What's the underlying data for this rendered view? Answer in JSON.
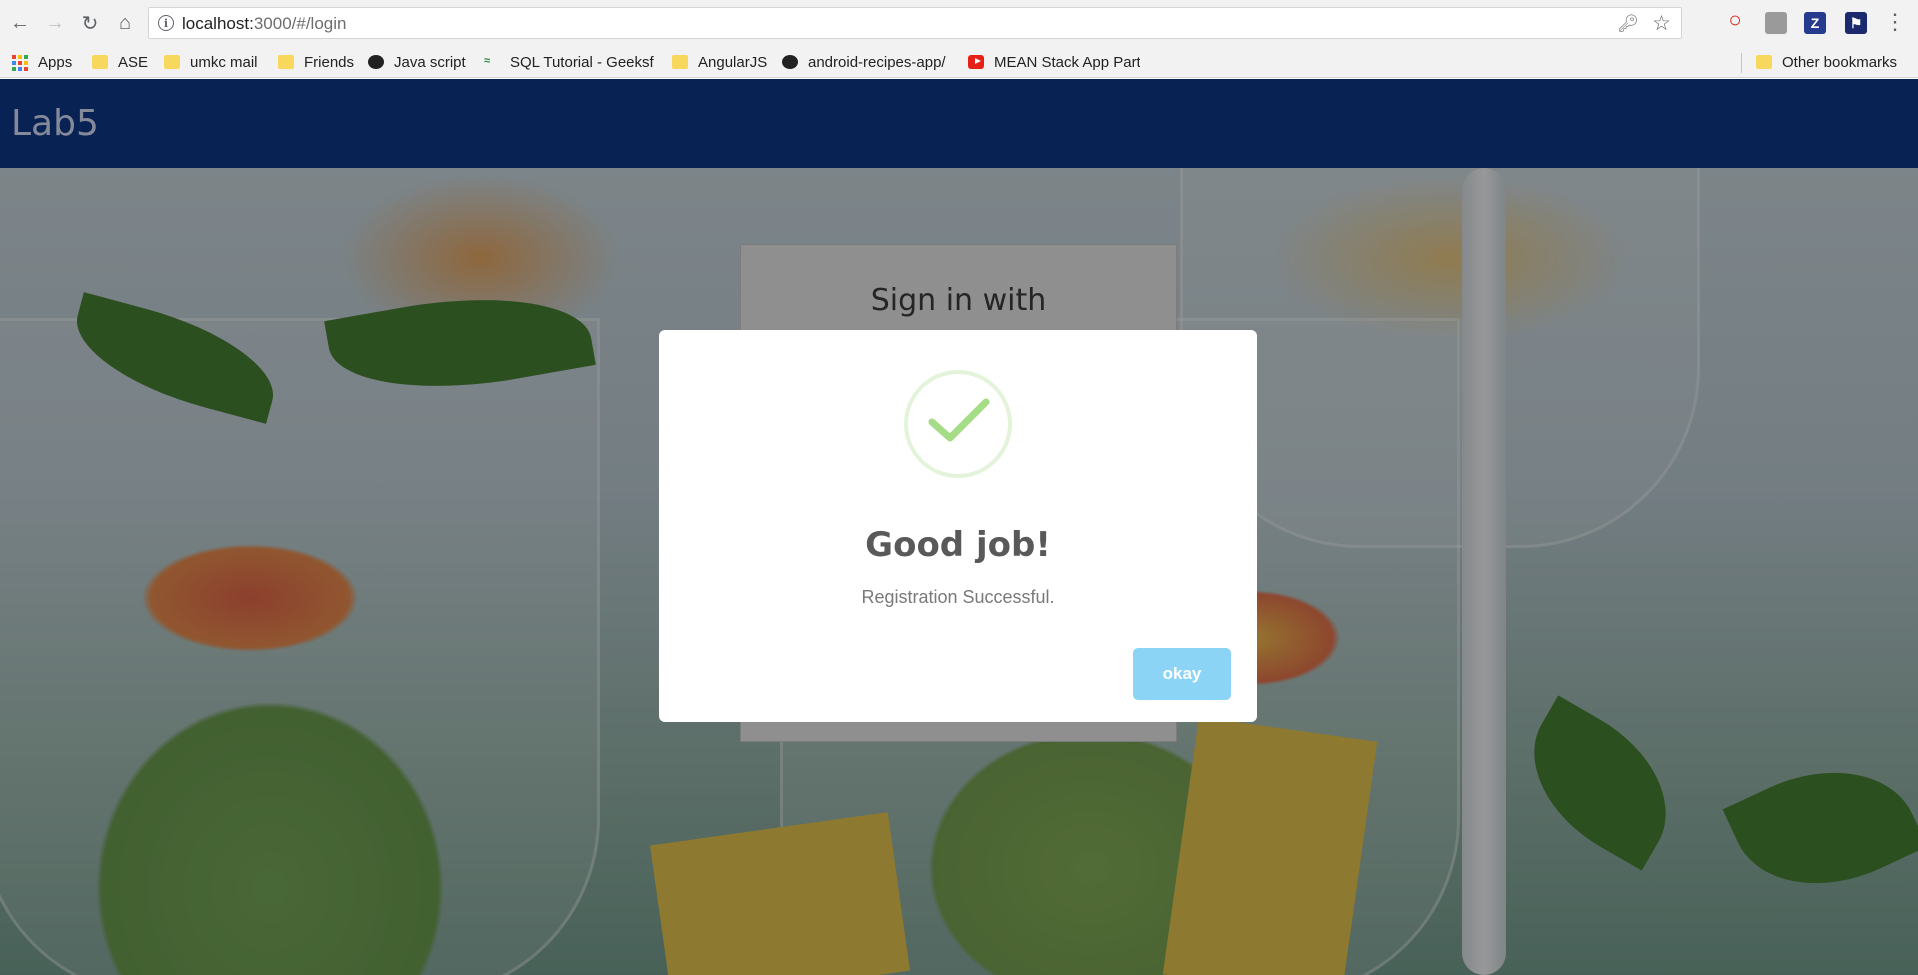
{
  "browser": {
    "url_host": "localhost:",
    "url_rest": "3000/#/login",
    "bookmarks": [
      {
        "label": "Apps",
        "icon": "apps-grid-icon"
      },
      {
        "label": "ASE",
        "icon": "folder-icon"
      },
      {
        "label": "umkc mail",
        "icon": "folder-icon"
      },
      {
        "label": "Friends",
        "icon": "folder-icon"
      },
      {
        "label": "Java script",
        "icon": "github-icon"
      },
      {
        "label": "SQL Tutorial - Geeksf",
        "icon": "geeksforgeeks-icon"
      },
      {
        "label": "AngularJS",
        "icon": "folder-icon"
      },
      {
        "label": "android-recipes-app/",
        "icon": "github-icon"
      },
      {
        "label": "MEAN Stack App Part",
        "icon": "youtube-icon"
      }
    ],
    "other_bookmarks": "Other bookmarks",
    "extensions": {
      "z_label": "Z"
    }
  },
  "app": {
    "brand": "Lab5",
    "login_title": "Sign in with"
  },
  "modal": {
    "title": "Good job!",
    "text": "Registration Successful.",
    "button": "okay"
  },
  "colors": {
    "navbar": "#0b2e6f",
    "success_check": "#a5dc86",
    "okay_button": "#8cd4f5"
  }
}
